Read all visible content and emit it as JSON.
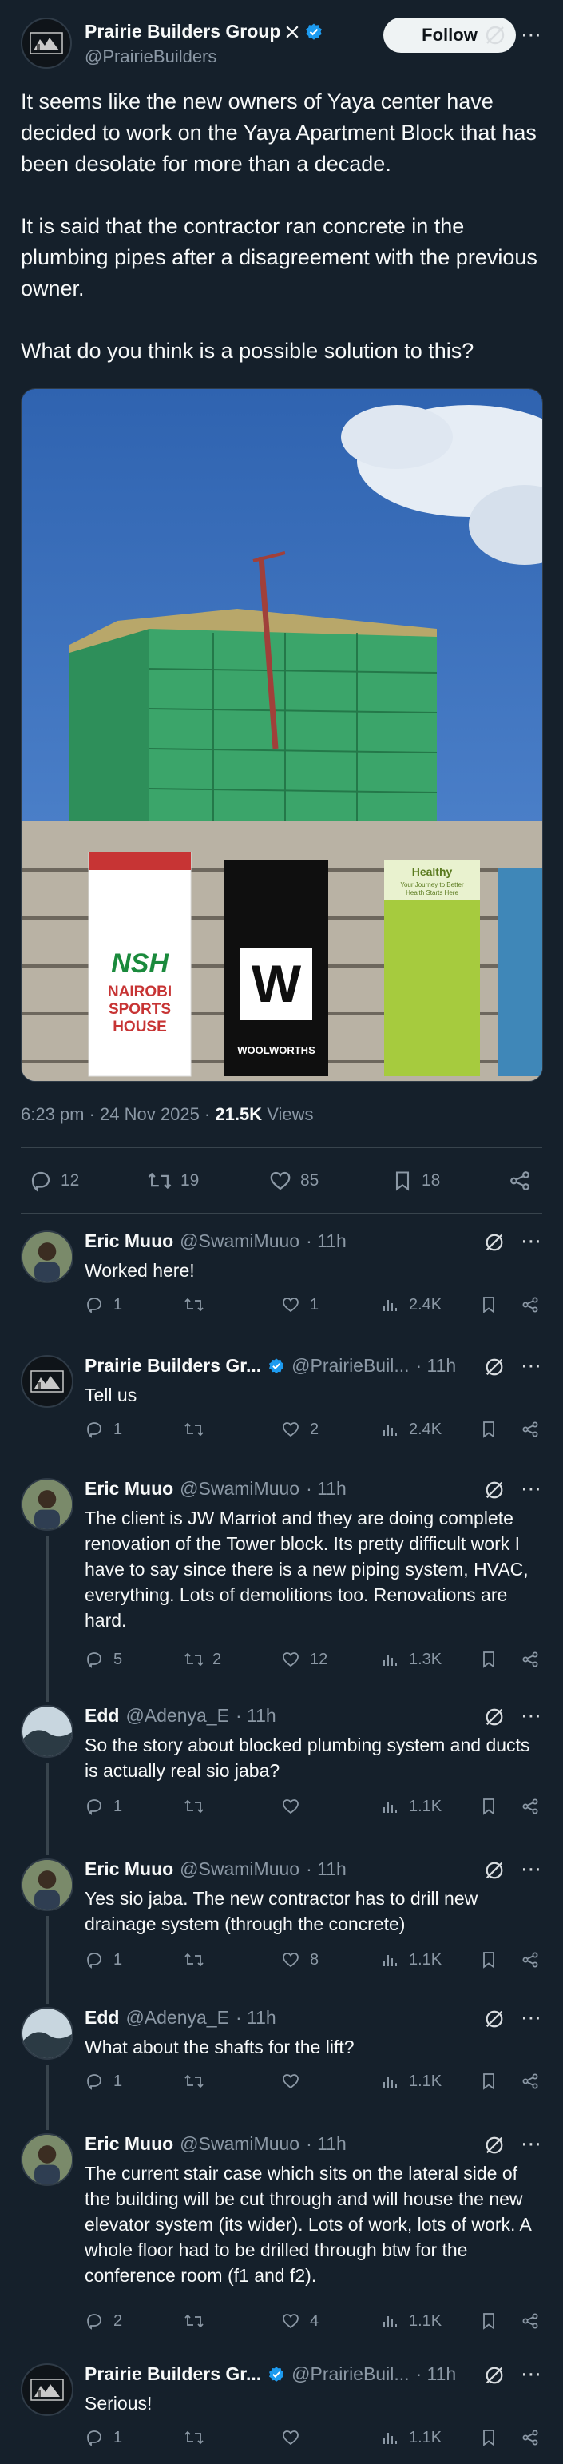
{
  "post": {
    "author_name": "Prairie Builders Group",
    "author_handle": "@PrairieBuilders",
    "follow_label": "Follow",
    "text": "It seems like the new owners of Yaya center have decided to work on the Yaya Apartment Block that has been desolate for more than a decade.\n\nIt is said that the contractor ran concrete in the plumbing pipes after a disagreement with the previous owner.\n\nWhat do you think is a possible solution to this?",
    "time": "6:23 pm · 24 Nov 2025 · ",
    "views_count": "21.5K",
    "views_label": " Views",
    "replies": "12",
    "reposts": "19",
    "likes": "85",
    "bookmarks": "18",
    "media_signs": {
      "nsh_logo": "NSH",
      "nsh_text": "NAIROBI SPORTS HOUSE",
      "w_letter": "W",
      "woolworths": "WOOLWORTHS",
      "healthy": "Healthy",
      "healthy_sub": "Your Journey to Better Health Starts Here"
    }
  },
  "replies": [
    {
      "name": "Eric Muuo",
      "handle": "@SwamiMuuo",
      "time": "· 11h",
      "verified": false,
      "text": "Worked here!",
      "replies": "1",
      "reposts": "",
      "likes": "1",
      "views": "2.4K"
    },
    {
      "name": "Prairie Builders Gr...",
      "handle": "@PrairieBuil...",
      "time": "· 11h",
      "verified": true,
      "text": "Tell us",
      "replies": "1",
      "reposts": "",
      "likes": "2",
      "views": "2.4K"
    },
    {
      "name": "Eric Muuo",
      "handle": "@SwamiMuuo",
      "time": "· 11h",
      "verified": false,
      "text": "The client is JW Marriot and they are doing complete renovation of the Tower block. Its pretty difficult work I have to say since there is a  new piping system, HVAC, everything. Lots of demolitions too. Renovations are hard.",
      "replies": "5",
      "reposts": "2",
      "likes": "12",
      "views": "1.3K"
    },
    {
      "name": "Edd",
      "handle": "@Adenya_E",
      "time": "· 11h",
      "verified": false,
      "text": "So the story about blocked plumbing system and ducts is actually real sio jaba?",
      "replies": "1",
      "reposts": "",
      "likes": "",
      "views": "1.1K"
    },
    {
      "name": "Eric Muuo",
      "handle": "@SwamiMuuo",
      "time": "· 11h",
      "verified": false,
      "text": "Yes sio jaba. The new contractor has to drill new drainage system (through the concrete)",
      "replies": "1",
      "reposts": "",
      "likes": "8",
      "views": "1.1K"
    },
    {
      "name": "Edd",
      "handle": "@Adenya_E",
      "time": "· 11h",
      "verified": false,
      "text": "What about the shafts for the lift?",
      "replies": "1",
      "reposts": "",
      "likes": "",
      "views": "1.1K"
    },
    {
      "name": "Eric Muuo",
      "handle": "@SwamiMuuo",
      "time": "· 11h",
      "verified": false,
      "text": "The current stair case which sits on the lateral side of the building will be cut through and will house the new elevator system (its wider). Lots of work, lots of work. A whole floor had to be drilled through btw for the conference room (f1 and f2).",
      "replies": "2",
      "reposts": "",
      "likes": "4",
      "views": "1.1K"
    },
    {
      "name": "Prairie Builders Gr...",
      "handle": "@PrairieBuil...",
      "time": "· 11h",
      "verified": true,
      "text": "Serious!",
      "replies": "1",
      "reposts": "",
      "likes": "",
      "views": "1.1K"
    }
  ]
}
